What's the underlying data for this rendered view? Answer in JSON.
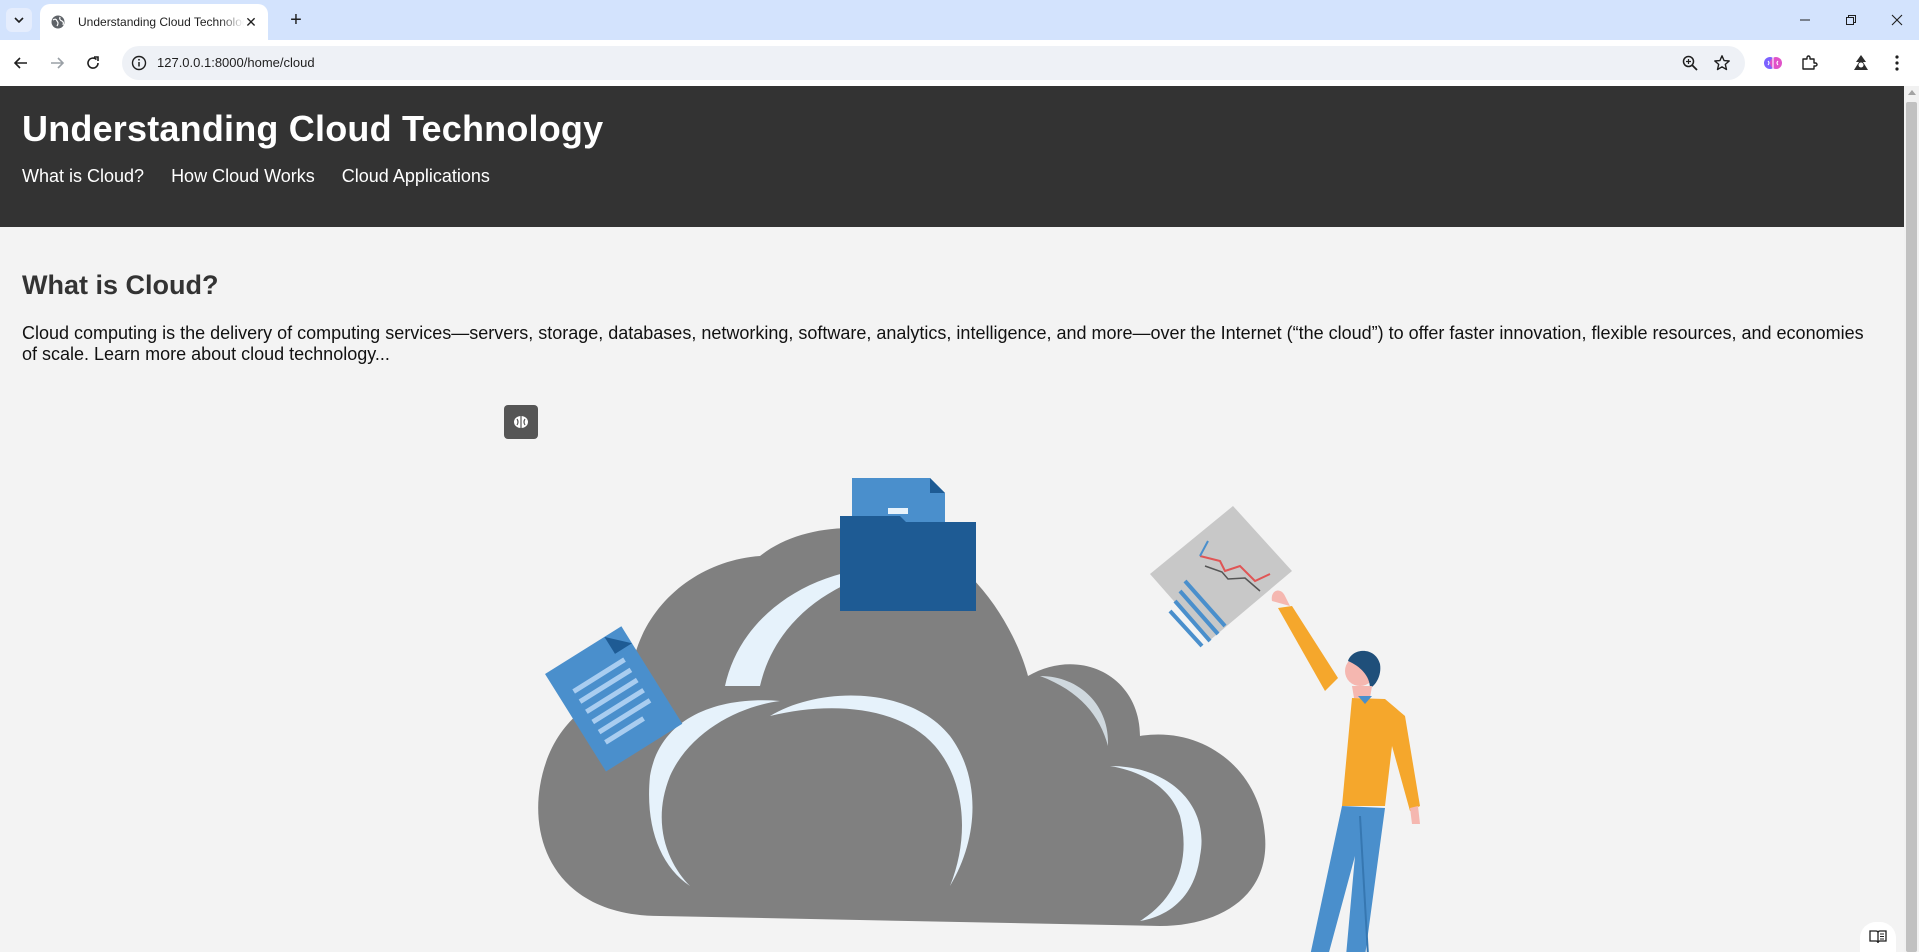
{
  "browser": {
    "tab_title": "Understanding Cloud Technology",
    "url": "127.0.0.1:8000/home/cloud"
  },
  "header": {
    "title": "Understanding Cloud Technology",
    "nav": [
      "What is Cloud?",
      "How Cloud Works",
      "Cloud Applications"
    ]
  },
  "main": {
    "section_title": "What is Cloud?",
    "intro": "Cloud computing is the delivery of computing services—servers, storage, databases, networking, software, analytics, intelligence, and more—over the Internet (“the cloud”) to offer faster innovation, flexible resources, and economies of scale. Learn more about cloud technology..."
  },
  "illustration": {
    "name": "cloud-illustration",
    "colors": {
      "cloud": "#808080",
      "cloud_highlight": "#e6f2fb",
      "folder": "#1e5b94",
      "folder_tab": "#4a8fcc",
      "document": "#4a8fcc",
      "chart_paper": "#c8c8c8",
      "sweater": "#f5a72c",
      "jeans": "#4a8fcc",
      "hair": "#1f4f7a",
      "skin": "#f5b7b0"
    }
  },
  "icons": {
    "tab_favicon": "globe-icon",
    "site_info": "info-icon",
    "zoom": "zoom-icon",
    "bookmark": "star-icon",
    "extension_brain": "brain-icon",
    "extensions": "puzzle-icon",
    "profile": "profile-icon",
    "menu": "kebab-menu-icon",
    "reader": "reading-mode-icon"
  },
  "theme": {
    "header_bg": "#333333",
    "page_bg": "#f3f3f3",
    "tabbar_bg": "#d3e3fd"
  }
}
